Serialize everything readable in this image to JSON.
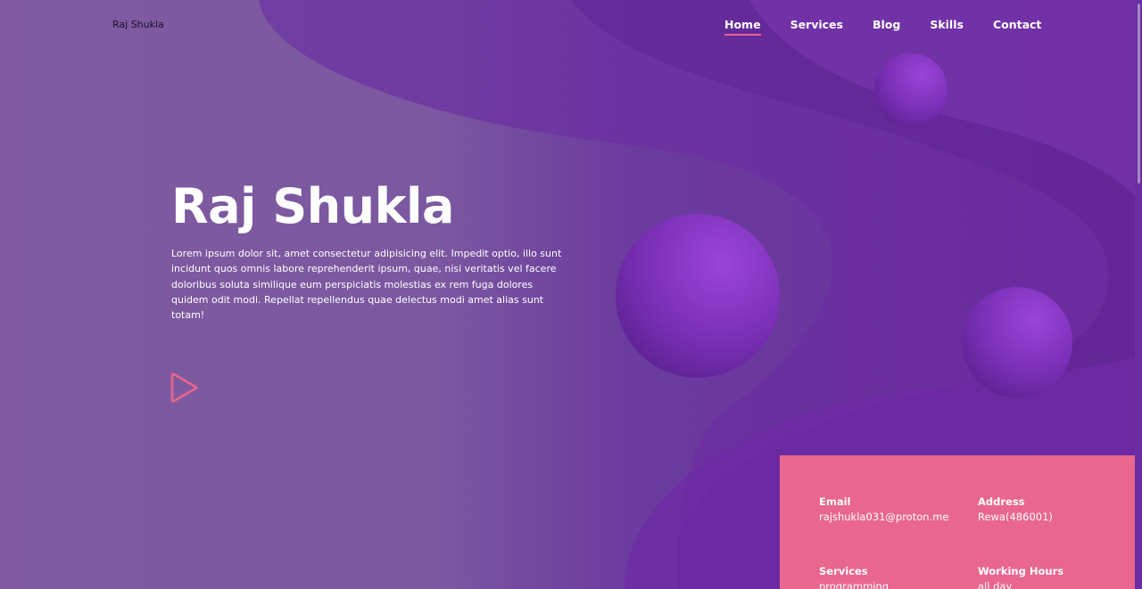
{
  "header": {
    "brand": "Raj Shukla",
    "nav": [
      "Home",
      "Services",
      "Blog",
      "Skills",
      "Contact"
    ],
    "active_nav": "Home"
  },
  "hero": {
    "title": "Raj Shukla",
    "description": "Lorem ipsum dolor sit, amet consectetur adipisicing elit. Impedit optio, illo sunt incidunt quos omnis labore reprehenderit ipsum, quae, nisi veritatis vel facere doloribus soluta similique eum perspiciatis molestias ex rem fuga dolores quidem odit modi. Repellat repellendus quae delectus modi amet alias sunt totam!",
    "play_icon": "play-icon"
  },
  "info": {
    "email_label": "Email",
    "email_value": "rajshukla031@proton.me",
    "address_label": "Address",
    "address_value": "Rewa(486001)",
    "services_label": "Services",
    "services_value": "programming",
    "hours_label": "Working Hours",
    "hours_value": "all day"
  },
  "colors": {
    "accent": "#e9668f",
    "purple": "#6a2f9f",
    "background": "#7d5a9f"
  }
}
